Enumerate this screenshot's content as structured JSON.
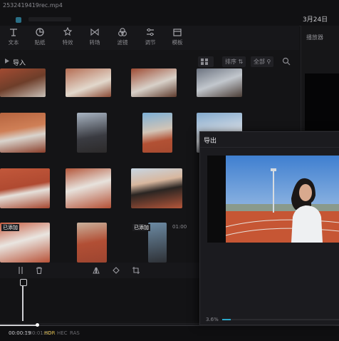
{
  "window": {
    "title": "2532419419rec.mp4",
    "date_text": "3月24日"
  },
  "toolbar": {
    "tools": [
      {
        "name": "text",
        "label": "文本",
        "icon": "text-icon"
      },
      {
        "name": "sticker",
        "label": "贴纸",
        "icon": "sticker-icon"
      },
      {
        "name": "effects",
        "label": "特效",
        "icon": "effects-icon"
      },
      {
        "name": "transitions",
        "label": "转场",
        "icon": "transition-icon"
      },
      {
        "name": "filters",
        "label": "滤镜",
        "icon": "filter-icon"
      },
      {
        "name": "adjust",
        "label": "调节",
        "icon": "adjust-icon"
      },
      {
        "name": "template",
        "label": "模板",
        "icon": "template-icon"
      }
    ]
  },
  "player": {
    "label": "播放器"
  },
  "media": {
    "import_label": "导入",
    "sort_label": "排序",
    "filter_label": "全部",
    "items": [
      {
        "caption": "",
        "badge": ""
      },
      {
        "caption": "",
        "badge": ""
      },
      {
        "caption": "",
        "badge": ""
      },
      {
        "caption": "",
        "badge": ""
      },
      {
        "caption": "",
        "badge": ""
      },
      {
        "caption": "",
        "badge": ""
      },
      {
        "caption": "",
        "badge": ""
      },
      {
        "caption": "",
        "badge": ""
      },
      {
        "caption": "",
        "badge": ""
      },
      {
        "caption": "",
        "badge": ""
      },
      {
        "caption": "",
        "badge": ""
      },
      {
        "caption": "",
        "badge": ""
      },
      {
        "caption": "",
        "badge": "已添加"
      },
      {
        "caption": "",
        "badge": ""
      },
      {
        "caption": "",
        "badge": "已添加"
      },
      {
        "caption": "",
        "badge": "01:00"
      }
    ]
  },
  "export": {
    "title": "导出",
    "progress_text": "3.6%",
    "progress": 0.036
  },
  "bottom": {
    "current_time": "00:00:19",
    "total_time": "/ 00:01:50",
    "tags": [
      "HDR",
      "HEC",
      "RAS"
    ],
    "progress": 0.11
  },
  "colors": {
    "accent": "#2aa7c9",
    "badge_hdr": "#d9b84a"
  }
}
